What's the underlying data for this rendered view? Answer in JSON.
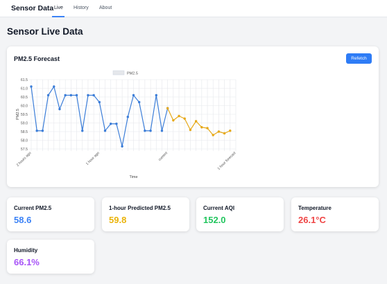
{
  "nav": {
    "brand": "Sensor Data",
    "links": [
      {
        "label": "Live",
        "active": true
      },
      {
        "label": "History",
        "active": false
      },
      {
        "label": "About",
        "active": false
      }
    ]
  },
  "page": {
    "title": "Sensor Live Data"
  },
  "chart_card": {
    "title": "PM2.5 Forecast",
    "refetch_label": "Refetch"
  },
  "chart_data": {
    "type": "line",
    "legend": {
      "label": "PM2.5",
      "placement": "top-center"
    },
    "xlabel": "Time",
    "ylabel": "PM2.5",
    "ylim": [
      57.5,
      61.5
    ],
    "yticks": [
      "61.5",
      "61.0",
      "60.5",
      "60.0",
      "59.5",
      "59.0",
      "58.5",
      "58.0",
      "57.5"
    ],
    "ytick_values": [
      61.5,
      61.0,
      60.5,
      60.0,
      59.5,
      59.0,
      58.5,
      58.0,
      57.5
    ],
    "grid": true,
    "xtick_labels": [
      {
        "index": 0,
        "text": "2 hours ago"
      },
      {
        "index": 12,
        "text": "1 hour ago"
      },
      {
        "index": 24,
        "text": "current"
      },
      {
        "index": 36,
        "text": "1 hour forecast"
      }
    ],
    "total_points": 37,
    "series": [
      {
        "name": "PM2.5",
        "color": "#3b7dd8",
        "start_index": 0,
        "values": [
          61.1,
          58.55,
          58.55,
          60.6,
          61.1,
          59.8,
          60.6,
          60.6,
          60.6,
          58.55,
          60.6,
          60.6,
          60.2,
          58.55,
          58.95,
          58.95,
          57.65,
          59.35,
          60.6,
          60.2,
          58.55,
          58.55,
          60.6,
          58.55,
          59.85
        ]
      },
      {
        "name": "PM2.5 (forecast)",
        "color": "#e6a817",
        "start_index": 24,
        "values": [
          59.85,
          59.15,
          59.4,
          59.25,
          58.6,
          59.1,
          58.75,
          58.7,
          58.3,
          58.5,
          58.4,
          58.55
        ]
      }
    ]
  },
  "stats": [
    {
      "label": "Current PM2.5",
      "value": "58.6",
      "color": "#3b82f6"
    },
    {
      "label": "1-hour Predicted PM2.5",
      "value": "59.8",
      "color": "#eab308"
    },
    {
      "label": "Current AQI",
      "value": "152.0",
      "color": "#22c55e"
    },
    {
      "label": "Temperature",
      "value": "26.1°C",
      "color": "#ef4444"
    },
    {
      "label": "Humidity",
      "value": "66.1%",
      "color": "#a855f7"
    }
  ]
}
